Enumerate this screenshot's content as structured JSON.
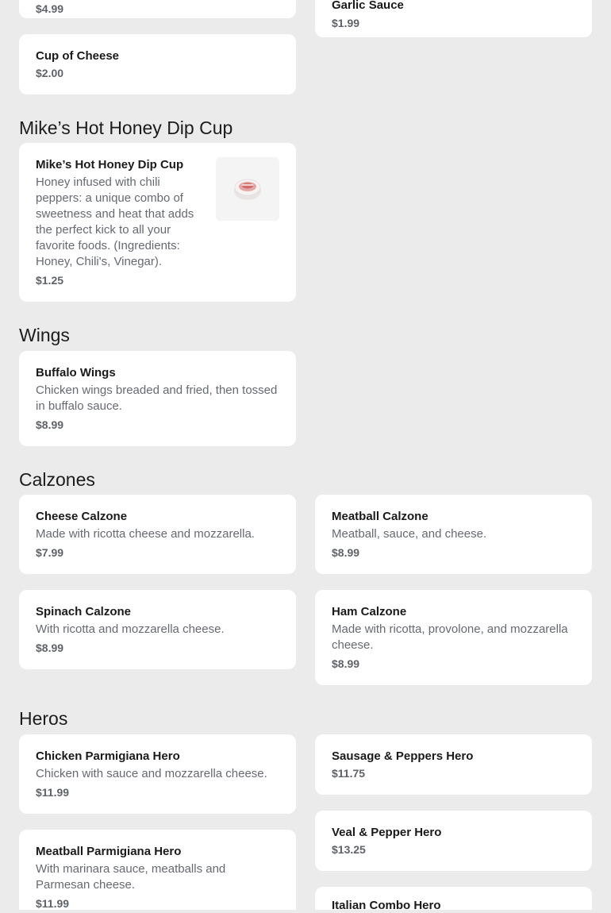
{
  "partial_top": {
    "left_price": "$4.99",
    "right_name": "Garlic Sauce",
    "right_price": "$1.99"
  },
  "sauces": {
    "cup_of_cheese": {
      "name": "Cup of Cheese",
      "price": "$2.00"
    }
  },
  "dip_section": {
    "title": "Mike’s Hot Honey Dip Cup",
    "item": {
      "name": "Mike’s Hot Honey Dip Cup",
      "desc": "Honey infused with chili peppers: a unique combo of sweetness and heat that adds the perfect kick to all your favorite foods. (Ingredients: Honey, Chili's, Vinegar).",
      "price": "$1.25"
    }
  },
  "wings_section": {
    "title": "Wings",
    "items": [
      {
        "name": "Buffalo Wings",
        "desc": "Chicken wings breaded and fried, then tossed in buffalo sauce.",
        "price": "$8.99"
      }
    ]
  },
  "calzones_section": {
    "title": "Calzones",
    "items": [
      {
        "name": "Cheese Calzone",
        "desc": "Made with ricotta cheese and mozzarella.",
        "price": "$7.99"
      },
      {
        "name": "Meatball Calzone",
        "desc": "Meatball, sauce, and cheese.",
        "price": "$8.99"
      },
      {
        "name": "Spinach Calzone",
        "desc": "With ricotta and mozzarella cheese.",
        "price": "$8.99"
      },
      {
        "name": "Ham Calzone",
        "desc": "Made with ricotta, provolone, and mozzarella cheese.",
        "price": "$8.99"
      }
    ]
  },
  "heros_section": {
    "title": "Heros",
    "items": [
      {
        "name": "Chicken Parmigiana Hero",
        "desc": "Chicken with sauce and mozzarella cheese.",
        "price": "$11.99"
      },
      {
        "name": "Sausage & Peppers Hero",
        "price": "$11.75"
      },
      {
        "name": "Meatball Parmigiana Hero",
        "desc": "With marinara sauce, meatballs and Parmesan cheese.",
        "price": "$11.99"
      },
      {
        "name": "Veal & Pepper Hero",
        "price": "$13.25"
      },
      {
        "name": "Italian Combo Hero"
      }
    ]
  }
}
